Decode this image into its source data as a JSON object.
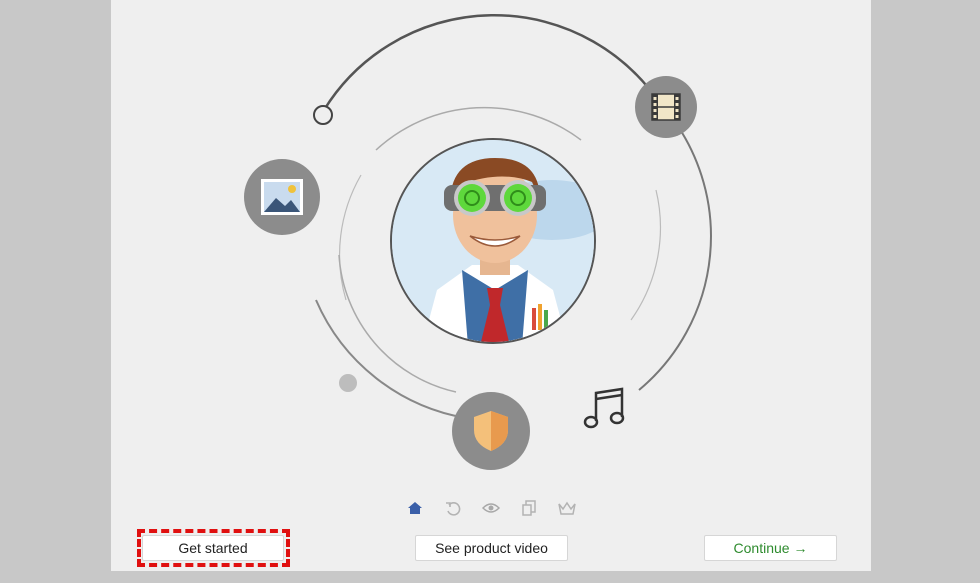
{
  "buttons": {
    "get_started": "Get started",
    "product_video": "See product video",
    "continue": "Continue →"
  },
  "icons": {
    "photo": "photo-icon",
    "film": "film-icon",
    "shield": "shield-icon",
    "music": "music-note-icon",
    "mascot": "mascot-avatar"
  },
  "stepper": [
    {
      "name": "home-step-icon",
      "active": true
    },
    {
      "name": "undo-step-icon",
      "active": false
    },
    {
      "name": "eye-step-icon",
      "active": false
    },
    {
      "name": "copy-step-icon",
      "active": false
    },
    {
      "name": "crown-step-icon",
      "active": false
    }
  ],
  "colors": {
    "accent": "#3a5fa8",
    "continue_text": "#2e8b2e",
    "highlight": "#e01010",
    "icon_disc": "#8c8c8c"
  }
}
